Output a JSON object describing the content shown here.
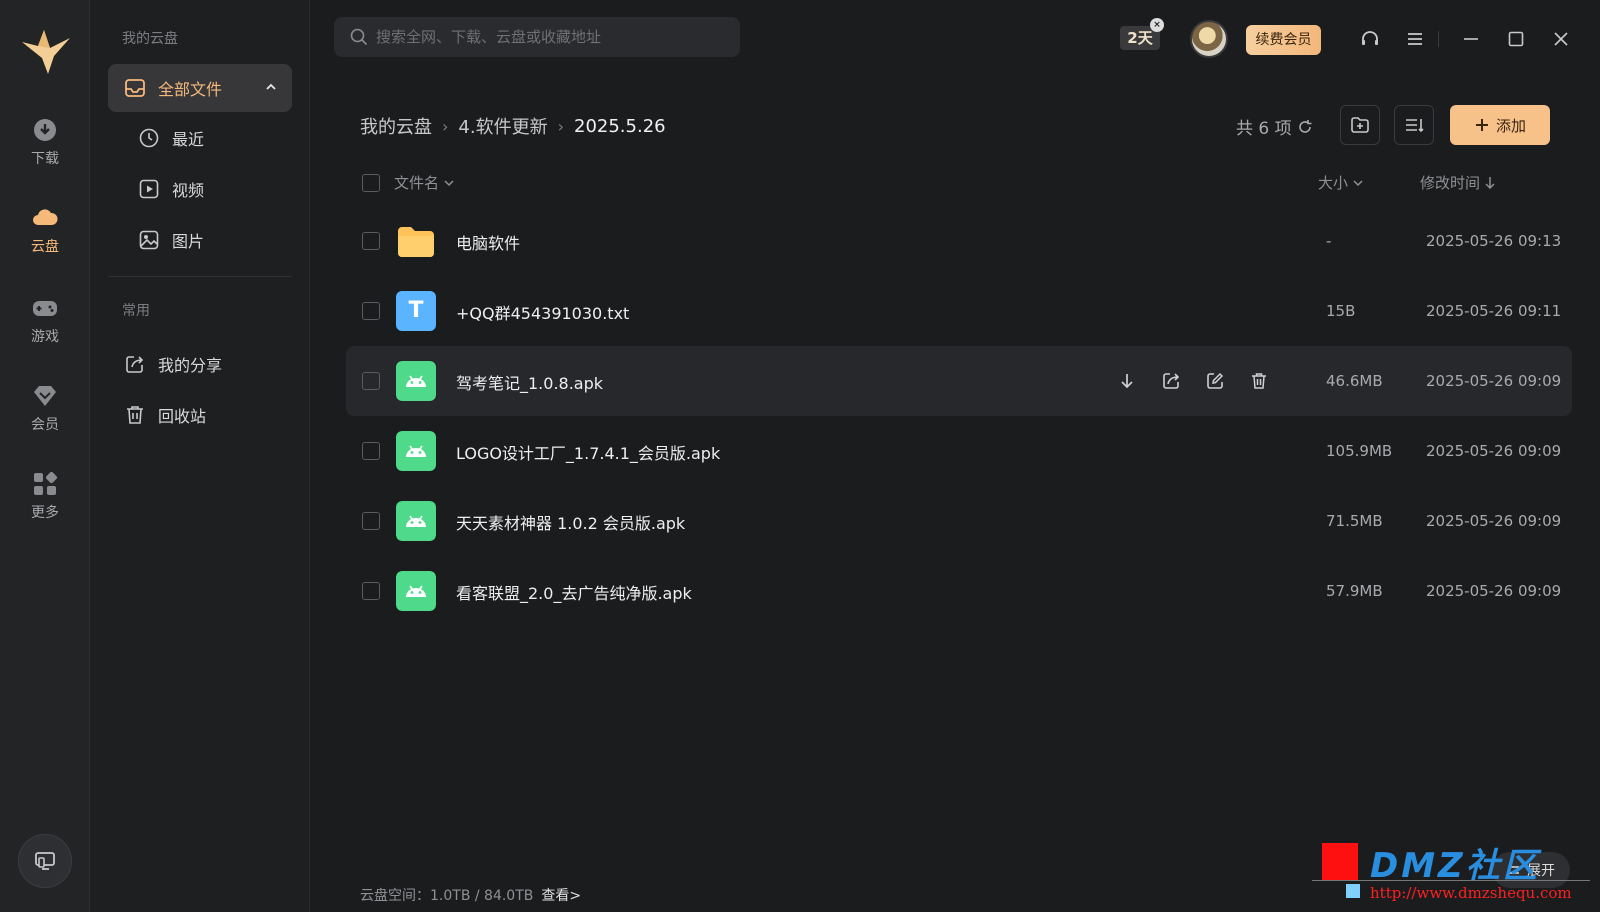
{
  "rail": {
    "items": [
      {
        "label": "下载"
      },
      {
        "label": "云盘"
      },
      {
        "label": "游戏"
      },
      {
        "label": "会员"
      },
      {
        "label": "更多"
      }
    ]
  },
  "sidebar": {
    "section_cloud": "我的云盘",
    "all_files": "全部文件",
    "recent": "最近",
    "video": "视频",
    "image": "图片",
    "section_common": "常用",
    "my_share": "我的分享",
    "recycle": "回收站"
  },
  "search": {
    "placeholder": "搜索全网、下载、云盘或收藏地址"
  },
  "topbar": {
    "days_badge": "2天",
    "badge_close": "×",
    "vip_label": "续费会员"
  },
  "breadcrumb": {
    "items": [
      "我的云盘",
      "4.软件更新",
      "2025.5.26"
    ],
    "separator": "›"
  },
  "toolbar": {
    "count": "共 6 项",
    "add_label": "添加"
  },
  "columns": {
    "name": "文件名",
    "size": "大小",
    "modified": "修改时间"
  },
  "files": [
    {
      "name": "电脑软件",
      "size": "-",
      "modified": "2025-05-26 09:13",
      "type": "folder"
    },
    {
      "name": "+QQ群454391030.txt",
      "size": "15B",
      "modified": "2025-05-26 09:11",
      "type": "text",
      "icon_letter": "T"
    },
    {
      "name": "驾考笔记_1.0.8.apk",
      "size": "46.6MB",
      "modified": "2025-05-26 09:09",
      "type": "apk"
    },
    {
      "name": "LOGO设计工厂_1.7.4.1_会员版.apk",
      "size": "105.9MB",
      "modified": "2025-05-26 09:09",
      "type": "apk"
    },
    {
      "name": "天天素材神器 1.0.2 会员版.apk",
      "size": "71.5MB",
      "modified": "2025-05-26 09:09",
      "type": "apk"
    },
    {
      "name": "看客联盟_2.0_去广告纯净版.apk",
      "size": "57.9MB",
      "modified": "2025-05-26 09:09",
      "type": "apk"
    }
  ],
  "footer": {
    "storage_label": "云盘空间：",
    "storage_value": "1.0TB / 84.0TB",
    "view_link": "查看>"
  },
  "expand_label": "展开",
  "watermark": {
    "brand": "DMZ社区",
    "url": "http://www.dmzshequ.com"
  },
  "colors": {
    "accent": "#f5b97a",
    "add_button": "#f7c18a",
    "folder": "#ffc35a",
    "apk": "#4fd98a",
    "text_icon": "#5ab4ff"
  }
}
